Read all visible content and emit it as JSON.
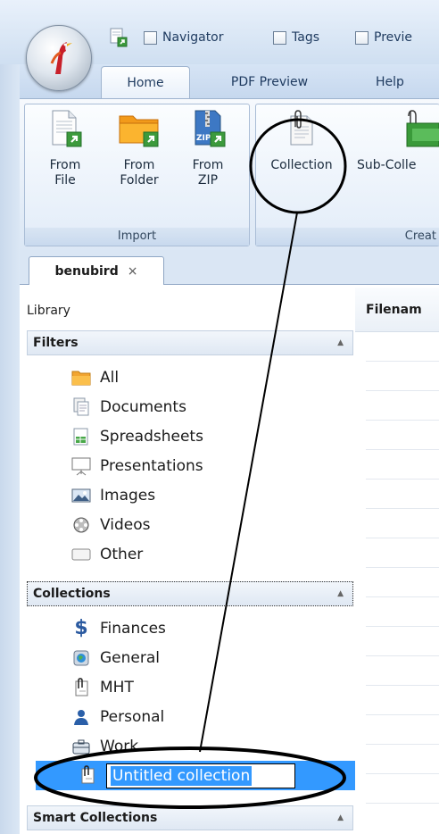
{
  "quick_access": {
    "navigator": "Navigator",
    "tags": "Tags",
    "preview": "Previe"
  },
  "ribbon_tabs": {
    "home": "Home",
    "pdf_preview": "PDF Preview",
    "help": "Help"
  },
  "ribbon": {
    "import_group": "Import",
    "create_group": "Creat",
    "from_file": [
      "From",
      "File"
    ],
    "from_folder": [
      "From",
      "Folder"
    ],
    "from_zip": [
      "From",
      "ZIP"
    ],
    "zip_badge": "ZIP",
    "collection": "Collection",
    "sub_collection": "Sub-Colle"
  },
  "document_tab": {
    "name": "benubird",
    "close": "×"
  },
  "library": {
    "title": "Library",
    "filters_header": "Filters",
    "filters": [
      "All",
      "Documents",
      "Spreadsheets",
      "Presentations",
      "Images",
      "Videos",
      "Other"
    ],
    "collections_header": "Collections",
    "collections": [
      "Finances",
      "General",
      "MHT",
      "Personal",
      "Work"
    ],
    "new_collection_value": "Untitled collection",
    "smart_collections_header": "Smart Collections"
  },
  "file_list": {
    "filename_header": "Filenam"
  },
  "colors": {
    "accent": "#3399ff",
    "annotation": "#000000"
  }
}
